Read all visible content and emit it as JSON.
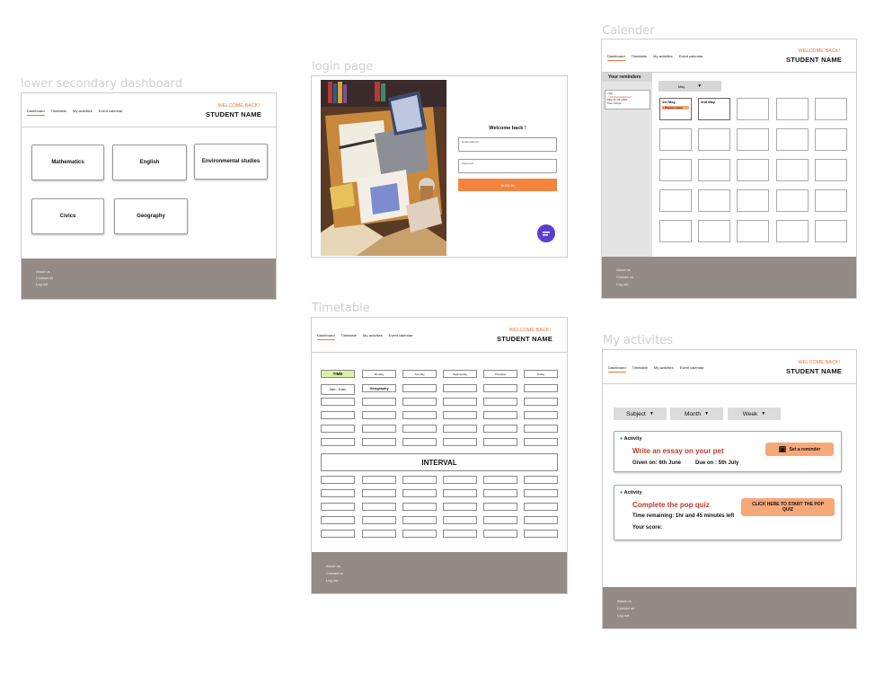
{
  "labels": {
    "dashboard": "lower secondary dashboard",
    "login": "login page",
    "calendar": "Calender",
    "timetable": "Timetable",
    "activities": "My activites"
  },
  "nav": {
    "dashboard": "Dashboard",
    "timetable": "Timetable",
    "activities": "My activities",
    "calendar": "Event calendar"
  },
  "header": {
    "welcome": "WELCOME BACK!",
    "student": "STUDENT NAME"
  },
  "footer": {
    "about": "About us",
    "contact": "Contact us",
    "logout": "Log out"
  },
  "dashboard": {
    "subjects": [
      "Mathematics",
      "English",
      "Environmental studies",
      "Civics",
      "Geography"
    ]
  },
  "login": {
    "title": "Welcome back !",
    "email_placeholder": "Email address",
    "password_placeholder": "Password",
    "signin": "SIGN IN"
  },
  "calendar": {
    "reminders_title": "Your reminders",
    "reminder_lines": [
      "• Pop",
      "• Unfinished assignment",
      "Date: 06 / 06 / 2020",
      "Time: 4:00 pm"
    ],
    "month": "May",
    "day1": "1st May",
    "event1": "• Physics exam",
    "day2": "2nd May"
  },
  "timetable": {
    "time_header": "TIME",
    "days": [
      "Monday",
      "Tuesday",
      "Wednesday",
      "Thursday",
      "Friday"
    ],
    "first_time": "9am - 10am",
    "first_subject": "Geography",
    "interval": "INTERVAL"
  },
  "activities": {
    "filters": {
      "subject": "Subject",
      "month": "Month",
      "week": "Week"
    },
    "card1": {
      "tag": "Activity",
      "title": "Write an essay on your pet",
      "given": "Given on: 6th June",
      "due": "Due on : 5th July",
      "button": "Set a reminder"
    },
    "card2": {
      "tag": "Activity",
      "title": "Complete the pop quiz",
      "time": "Time remaining: 1hr and 45 minutes left",
      "score": "Your score:",
      "button": "CLICK HERE TO START THE POP QUIZ"
    }
  }
}
